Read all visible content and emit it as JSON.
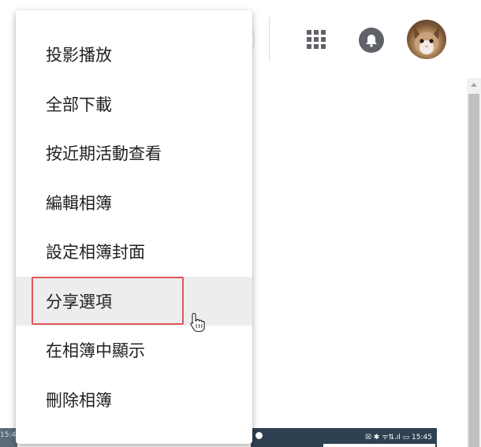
{
  "header": {
    "icons": [
      "apps-grid-icon",
      "notifications-bell-icon",
      "account-avatar"
    ]
  },
  "menu": {
    "items": [
      {
        "label": "投影播放"
      },
      {
        "label": "全部下載"
      },
      {
        "label": "按近期活動查看"
      },
      {
        "label": "編輯相簿"
      },
      {
        "label": "設定相簿封面"
      },
      {
        "label": "分享選項",
        "highlighted": true
      },
      {
        "label": "在相簿中顯示"
      },
      {
        "label": "刪除相簿"
      }
    ]
  },
  "thumbnails": {
    "left_time_fragment": "15:4",
    "right_status": "☒ ✱ ᯤ⇅.ıl ▭ 15:45"
  },
  "colors": {
    "highlight_border": "#e0565b",
    "hover_background": "#ededed",
    "icon_gray": "#5f6368"
  }
}
